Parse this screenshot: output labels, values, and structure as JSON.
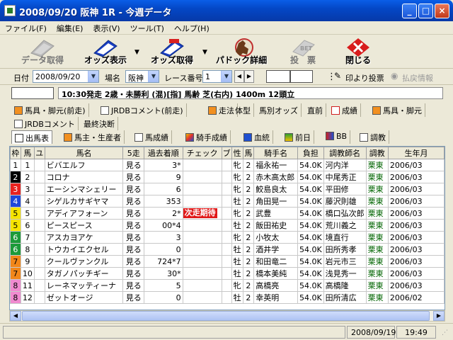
{
  "window": {
    "title": "2008/09/20 阪神 1R - 今週データ",
    "min": "_",
    "max": "□",
    "close": "×"
  },
  "menu": [
    "ファイル(F)",
    "編集(E)",
    "表示(V)",
    "ツール(T)",
    "ヘルプ(H)"
  ],
  "toolbar": {
    "data_get": "データ取得",
    "odds_view": "オッズ表示",
    "odds_get": "オッズ取得",
    "paddock": "パドック詳細",
    "vote": "投　票",
    "close": "閉じる"
  },
  "fields": {
    "date_label": "日付",
    "date_value": "2008/09/20",
    "venue_label": "場名",
    "venue_value": "阪神",
    "race_label": "レース番号",
    "race_value": "1",
    "print_vote": "印より投票",
    "refund": "払戻情報"
  },
  "race_info": "10:30発走 2歳・未勝利 (混)[指] 馬齢 芝(右内) 1400m 12頭立",
  "tabs_row1": [
    "馬具・脚元(前走)",
    "JRDBコメント(前走)",
    "走法",
    "体型",
    "馬別オッズ",
    "直前",
    "成績",
    "馬具・脚元"
  ],
  "tabs_row2": [
    "JRDBコメント",
    "最終決断"
  ],
  "tabs_row3": [
    "出馬表",
    "馬主・生産者",
    "馬成績",
    "騎手成績",
    "血統",
    "前日",
    "BB",
    "調教"
  ],
  "columns": [
    "枠",
    "馬",
    "ユ",
    "馬名",
    "5走",
    "過去着順",
    "チェック",
    "ブ",
    "性",
    "馬",
    "騎手名",
    "負担",
    "調教師名",
    "調教",
    "生年月"
  ],
  "rows": [
    {
      "waku": "1",
      "uma": "1",
      "name": "ビバエルフ",
      "go5": "見る",
      "past": "3*",
      "check": "",
      "sex": "牝",
      "age": "2",
      "jockey": "福永祐一",
      "weight": "54.0K",
      "trainer": "河内洋",
      "train": "栗東",
      "birth": "2006/03"
    },
    {
      "waku": "2",
      "uma": "2",
      "name": "コロナ",
      "go5": "見る",
      "past": "9",
      "check": "",
      "sex": "牝",
      "age": "2",
      "jockey": "赤木高太郎",
      "weight": "54.0K",
      "trainer": "中尾秀正",
      "train": "栗東",
      "birth": "2006/03"
    },
    {
      "waku": "3",
      "uma": "3",
      "name": "エーシンマシェリー",
      "go5": "見る",
      "past": "6",
      "check": "",
      "sex": "牝",
      "age": "2",
      "jockey": "鮫島良太",
      "weight": "54.0K",
      "trainer": "平田修",
      "train": "栗東",
      "birth": "2006/03"
    },
    {
      "waku": "4",
      "uma": "4",
      "name": "シゲルカサギヤマ",
      "go5": "見る",
      "past": "353",
      "check": "",
      "sex": "牡",
      "age": "2",
      "jockey": "角田晃一",
      "weight": "54.0K",
      "trainer": "藤沢則雄",
      "train": "栗東",
      "birth": "2006/03"
    },
    {
      "waku": "5",
      "uma": "5",
      "name": "アディアフォーン",
      "go5": "見る",
      "past": "2*",
      "check": "次走期待",
      "sex": "牝",
      "age": "2",
      "jockey": "武豊",
      "weight": "54.0K",
      "trainer": "橋口弘次郎",
      "train": "栗東",
      "birth": "2006/03"
    },
    {
      "waku": "5",
      "uma": "6",
      "name": "ピースピース",
      "go5": "見る",
      "past": "00*4",
      "check": "",
      "sex": "牡",
      "age": "2",
      "jockey": "飯田祐史",
      "weight": "54.0K",
      "trainer": "荒川義之",
      "train": "栗東",
      "birth": "2006/03"
    },
    {
      "waku": "6",
      "uma": "7",
      "name": "アスカヨアケ",
      "go5": "見る",
      "past": "3",
      "check": "",
      "sex": "牝",
      "age": "2",
      "jockey": "小牧太",
      "weight": "54.0K",
      "trainer": "境直行",
      "train": "栗東",
      "birth": "2006/03"
    },
    {
      "waku": "6",
      "uma": "8",
      "name": "トウカイエクセル",
      "go5": "見る",
      "past": "0",
      "check": "",
      "sex": "牡",
      "age": "2",
      "jockey": "酒井学",
      "weight": "54.0K",
      "trainer": "田所秀孝",
      "train": "栗東",
      "birth": "2006/03"
    },
    {
      "waku": "7",
      "uma": "9",
      "name": "クールヴァンクル",
      "go5": "見る",
      "past": "724*7",
      "check": "",
      "sex": "牡",
      "age": "2",
      "jockey": "和田竜二",
      "weight": "54.0K",
      "trainer": "岩元市三",
      "train": "栗東",
      "birth": "2006/03"
    },
    {
      "waku": "7",
      "uma": "10",
      "name": "タガノパッチギー",
      "go5": "見る",
      "past": "30*",
      "check": "",
      "sex": "牡",
      "age": "2",
      "jockey": "橋本美純",
      "weight": "54.0K",
      "trainer": "浅見秀一",
      "train": "栗東",
      "birth": "2006/03"
    },
    {
      "waku": "8",
      "uma": "11",
      "name": "レーネマッティーナ",
      "go5": "見る",
      "past": "5",
      "check": "",
      "sex": "牝",
      "age": "2",
      "jockey": "高橋亮",
      "weight": "54.0K",
      "trainer": "高橋隆",
      "train": "栗東",
      "birth": "2006/03"
    },
    {
      "waku": "8",
      "uma": "12",
      "name": "ゼットオージ",
      "go5": "見る",
      "past": "0",
      "check": "",
      "sex": "牡",
      "age": "2",
      "jockey": "幸英明",
      "weight": "54.0K",
      "trainer": "田所清広",
      "train": "栗東",
      "birth": "2006/02"
    }
  ],
  "waku_colors": {
    "1": "#ffffff",
    "2": "#000000",
    "3": "#e8221f",
    "4": "#2048d8",
    "5": "#f6e400",
    "6": "#1c9a3a",
    "7": "#f2871a",
    "8": "#f08ad0"
  },
  "waku_text": {
    "1": "#000000",
    "2": "#ffffff",
    "3": "#ffffff",
    "4": "#ffffff",
    "5": "#000000",
    "6": "#ffffff",
    "7": "#000000",
    "8": "#000000"
  },
  "status": {
    "date": "2008/09/19",
    "time": "19:49"
  }
}
